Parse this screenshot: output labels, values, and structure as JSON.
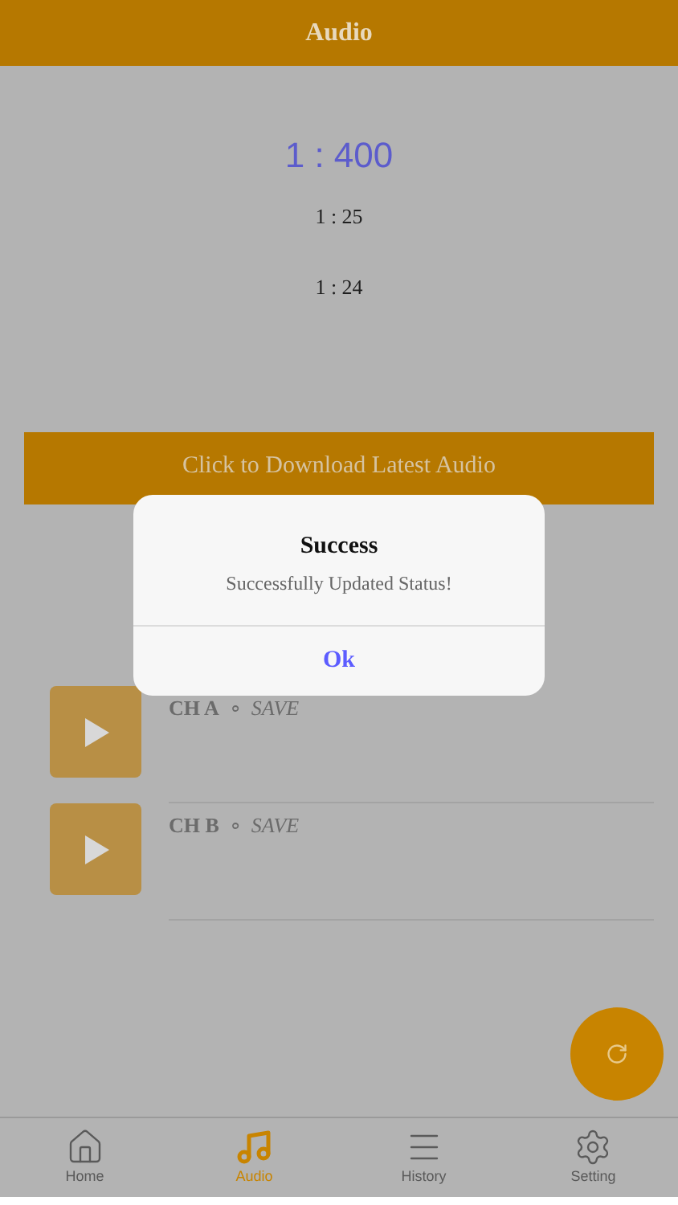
{
  "header": {
    "title": "Audio"
  },
  "ratios": [
    {
      "text": "1 : 400",
      "kind": "main"
    },
    {
      "text": "1 : 25",
      "kind": "sub"
    },
    {
      "text": "1 : 24",
      "kind": "sub"
    }
  ],
  "download_button": {
    "label": "Click to Download Latest Audio"
  },
  "channels": [
    {
      "name": "CH A",
      "separator": "∘",
      "status": "SAVE"
    },
    {
      "name": "CH B",
      "separator": "∘",
      "status": "SAVE"
    }
  ],
  "tabs": [
    {
      "label": "Home",
      "kind": "home",
      "selected": false
    },
    {
      "label": "Audio",
      "kind": "music",
      "selected": true
    },
    {
      "label": "History",
      "kind": "menu",
      "selected": false
    },
    {
      "label": "Setting",
      "kind": "gear",
      "selected": false
    }
  ],
  "dialog": {
    "title": "Success",
    "message": "Successfully Updated Status!",
    "button": "Ok"
  }
}
